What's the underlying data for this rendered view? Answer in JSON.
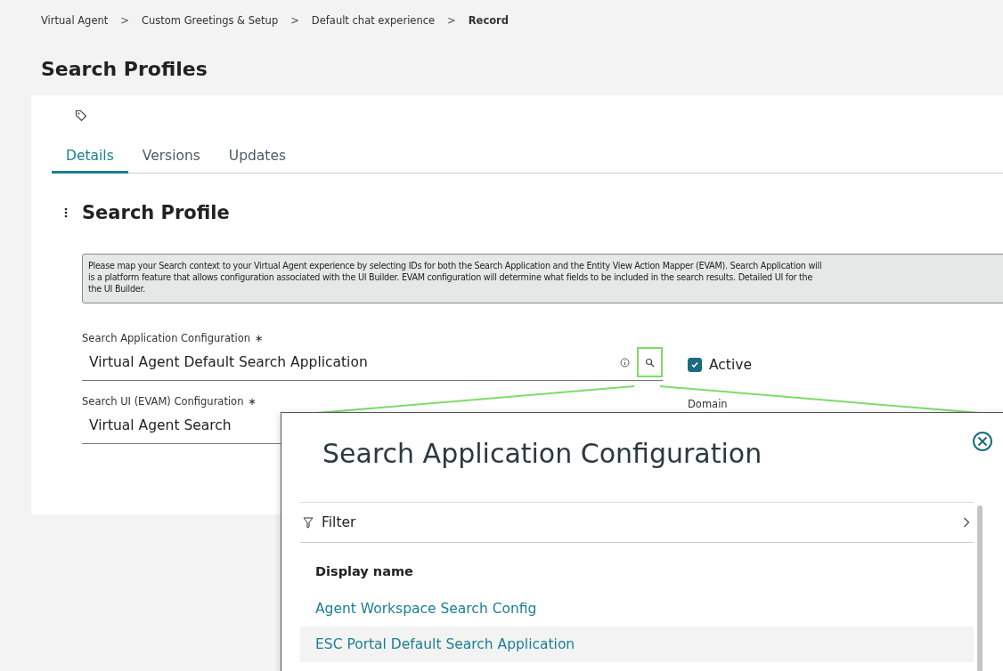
{
  "breadcrumb": [
    {
      "label": "Virtual Agent",
      "current": false
    },
    {
      "label": "Custom Greetings & Setup",
      "current": false
    },
    {
      "label": "Default chat experience",
      "current": false
    },
    {
      "label": "Record",
      "current": true
    }
  ],
  "breadcrumb_separator": ">",
  "page_title": "Search Profiles",
  "tabs": [
    {
      "label": "Details",
      "selected": true
    },
    {
      "label": "Versions",
      "selected": false
    },
    {
      "label": "Updates",
      "selected": false
    }
  ],
  "section_title": "Search Profile",
  "info_lines": [
    "Please map your Search context to your Virtual Agent experience by selecting IDs for both the Search Application and the Entity View Action Mapper (EVAM). Search Application will",
    "is a platform feature that allows configuration associated with the UI Builder. EVAM configuration will determine what fields to be included in the search results. Detailed UI for the",
    "the UI Builder."
  ],
  "fields": [
    {
      "label": "Search Application Configuration",
      "required": true,
      "value": "Virtual Agent Default Search Application",
      "lookup": true
    },
    {
      "label": "Search UI (EVAM) Configuration",
      "required": true,
      "value": "Virtual Agent Search",
      "lookup": false
    }
  ],
  "required_mark": "∗",
  "active": {
    "label": "Active",
    "checked": true
  },
  "domain_label": "Domain",
  "modal": {
    "title": "Search Application Configuration",
    "filter_label": "Filter",
    "column": "Display name",
    "rows": [
      {
        "label": "Agent Workspace Search Config",
        "selected": false
      },
      {
        "label": "ESC Portal Default Search Application",
        "selected": true
      }
    ]
  }
}
